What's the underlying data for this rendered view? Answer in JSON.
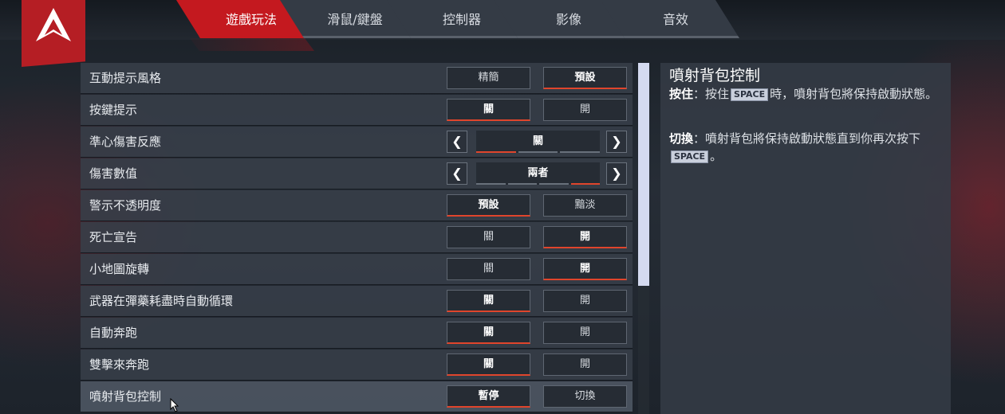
{
  "tabs": [
    {
      "label": "遊戲玩法",
      "active": true
    },
    {
      "label": "滑鼠/鍵盤",
      "active": false
    },
    {
      "label": "控制器",
      "active": false
    },
    {
      "label": "影像",
      "active": false
    },
    {
      "label": "音效",
      "active": false
    }
  ],
  "settings": [
    {
      "label": "互動提示風格",
      "options": [
        "精簡",
        "預設"
      ],
      "selected": 1
    },
    {
      "label": "按鍵提示",
      "options": [
        "關",
        "開"
      ],
      "selected": 0
    },
    {
      "label": "準心傷害反應",
      "value": "關",
      "segments": 3,
      "active_segment": 0
    },
    {
      "label": "傷害數值",
      "value": "兩者",
      "segments": 4,
      "active_segment": 3
    },
    {
      "label": "警示不透明度",
      "options": [
        "預設",
        "黯淡"
      ],
      "selected": 0
    },
    {
      "label": "死亡宣告",
      "options": [
        "關",
        "開"
      ],
      "selected": 1
    },
    {
      "label": "小地圖旋轉",
      "options": [
        "關",
        "開"
      ],
      "selected": 1
    },
    {
      "label": "武器在彈藥耗盡時自動循環",
      "options": [
        "關",
        "開"
      ],
      "selected": 0
    },
    {
      "label": "自動奔跑",
      "options": [
        "關",
        "開"
      ],
      "selected": 0
    },
    {
      "label": "雙擊來奔跑",
      "options": [
        "關",
        "開"
      ],
      "selected": 0
    },
    {
      "label": "噴射背包控制",
      "options": [
        "暫停",
        "切換"
      ],
      "selected": 0
    }
  ],
  "description": {
    "title": "噴射背包控制",
    "p1_term": "按住",
    "p1_pre": "：按住",
    "p1_key": "SPACE",
    "p1_post": "時，噴射背包將保持啟動狀態。",
    "p2_term": "切換",
    "p2_pre": "：噴射背包將保持啟動狀態直到你再次按下",
    "p2_key": "SPACE",
    "p2_post": "。"
  },
  "colors": {
    "accent": "#c4191f",
    "underline": "#e0452c",
    "scroll_thumb": "#d4daf0"
  },
  "icons": {
    "logo": "apex-logo-icon",
    "left": "chevron-left-icon",
    "right": "chevron-right-icon",
    "cursor": "mouse-pointer-icon"
  }
}
